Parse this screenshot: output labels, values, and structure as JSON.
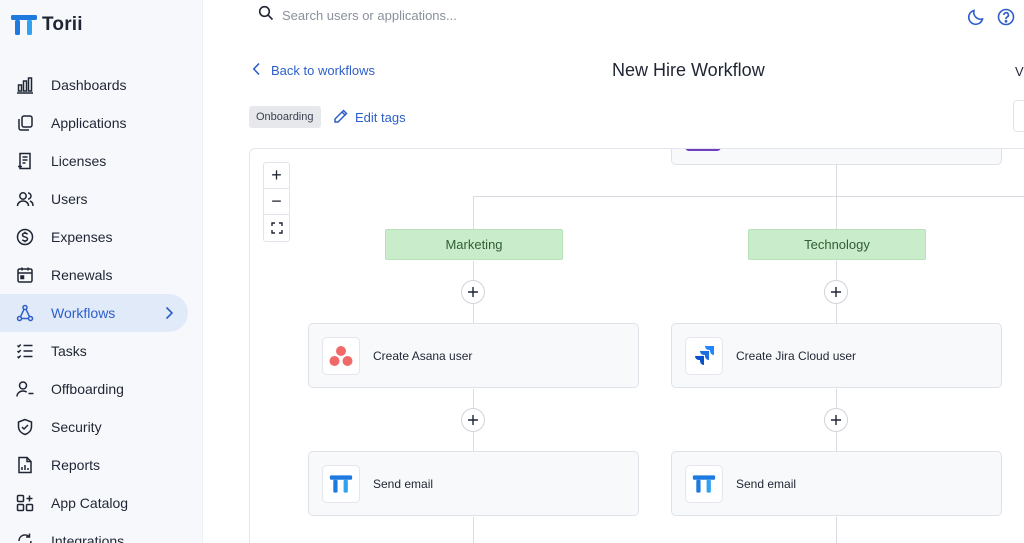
{
  "app": {
    "name": "Torii"
  },
  "sidebar": {
    "items": [
      {
        "label": "Dashboards",
        "icon": "dashboards-icon"
      },
      {
        "label": "Applications",
        "icon": "applications-icon"
      },
      {
        "label": "Licenses",
        "icon": "licenses-icon"
      },
      {
        "label": "Users",
        "icon": "users-icon"
      },
      {
        "label": "Expenses",
        "icon": "expenses-icon"
      },
      {
        "label": "Renewals",
        "icon": "renewals-icon"
      },
      {
        "label": "Workflows",
        "icon": "workflows-icon",
        "active": true
      },
      {
        "label": "Tasks",
        "icon": "tasks-icon"
      },
      {
        "label": "Offboarding",
        "icon": "offboarding-icon"
      },
      {
        "label": "Security",
        "icon": "security-icon"
      },
      {
        "label": "Reports",
        "icon": "reports-icon"
      },
      {
        "label": "App Catalog",
        "icon": "app-catalog-icon"
      },
      {
        "label": "Integrations",
        "icon": "integrations-icon"
      }
    ]
  },
  "search": {
    "placeholder": "Search users or applications..."
  },
  "header": {
    "back_label": "Back to workflows",
    "title": "New Hire Workflow",
    "edge_text": "V",
    "tag": "Onboarding",
    "edit_tags_label": "Edit tags"
  },
  "canvas": {
    "zoom": {
      "in": "+",
      "out": "−"
    },
    "branches": [
      {
        "label": "Marketing",
        "steps": [
          "Create Asana user",
          "Send email"
        ]
      },
      {
        "label": "Technology",
        "steps": [
          "Create Jira Cloud user",
          "Send email"
        ]
      }
    ]
  },
  "colors": {
    "accent": "#2e5fc9",
    "branch_bg": "#c9ecca",
    "asana": "#f06a6a",
    "jira": "#2684ff",
    "torii": "#1f7ae0",
    "purple": "#6c3fc2"
  }
}
